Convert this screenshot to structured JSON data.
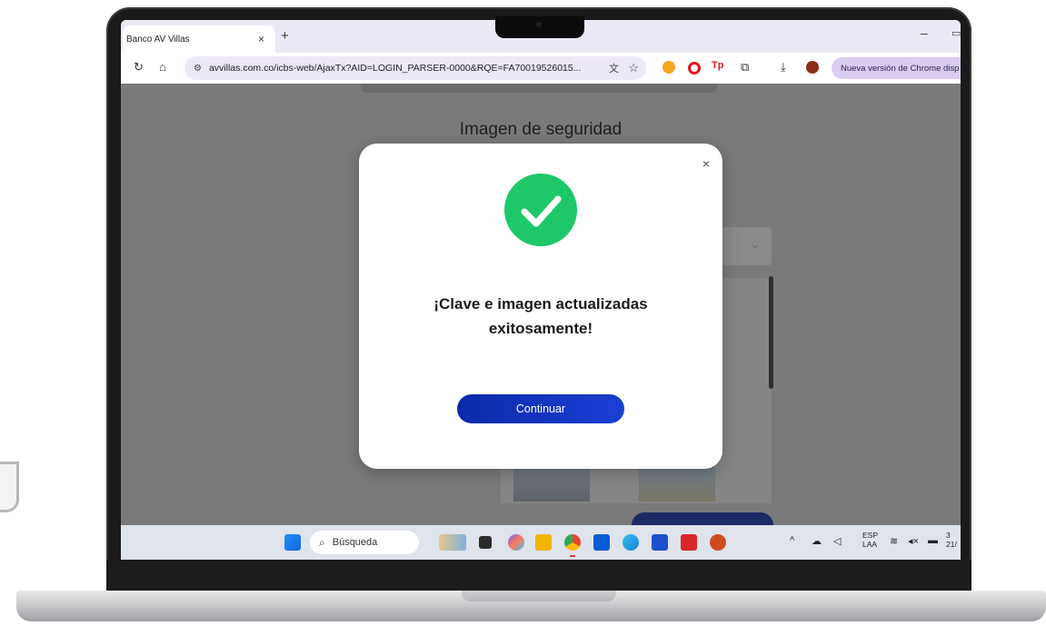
{
  "browser": {
    "tab_title": "Banco AV Villas",
    "tab_close": "×",
    "new_tab": "+",
    "url": "avvillas.com.co/icbs-web/AjaxTx?AID=LOGIN_PARSER-0000&RQE=FA70019526015...",
    "update_label": "Nueva versión de Chrome disp",
    "window_minimize": "–",
    "window_maximize": "▭"
  },
  "page": {
    "heading": "Imagen de seguridad"
  },
  "modal": {
    "close": "×",
    "message": "¡Clave e imagen actualizadas exitosamente!",
    "button_label": "Continuar"
  },
  "taskbar": {
    "search_placeholder": "Búsqueda",
    "lang_line1": "ESP",
    "lang_line2": "LAA",
    "clock_line1": "3",
    "clock_line2": "21/"
  },
  "colors": {
    "success": "#1ec86a",
    "primary_button": "#0b2aa8",
    "overlay": "#7a7a7a"
  }
}
